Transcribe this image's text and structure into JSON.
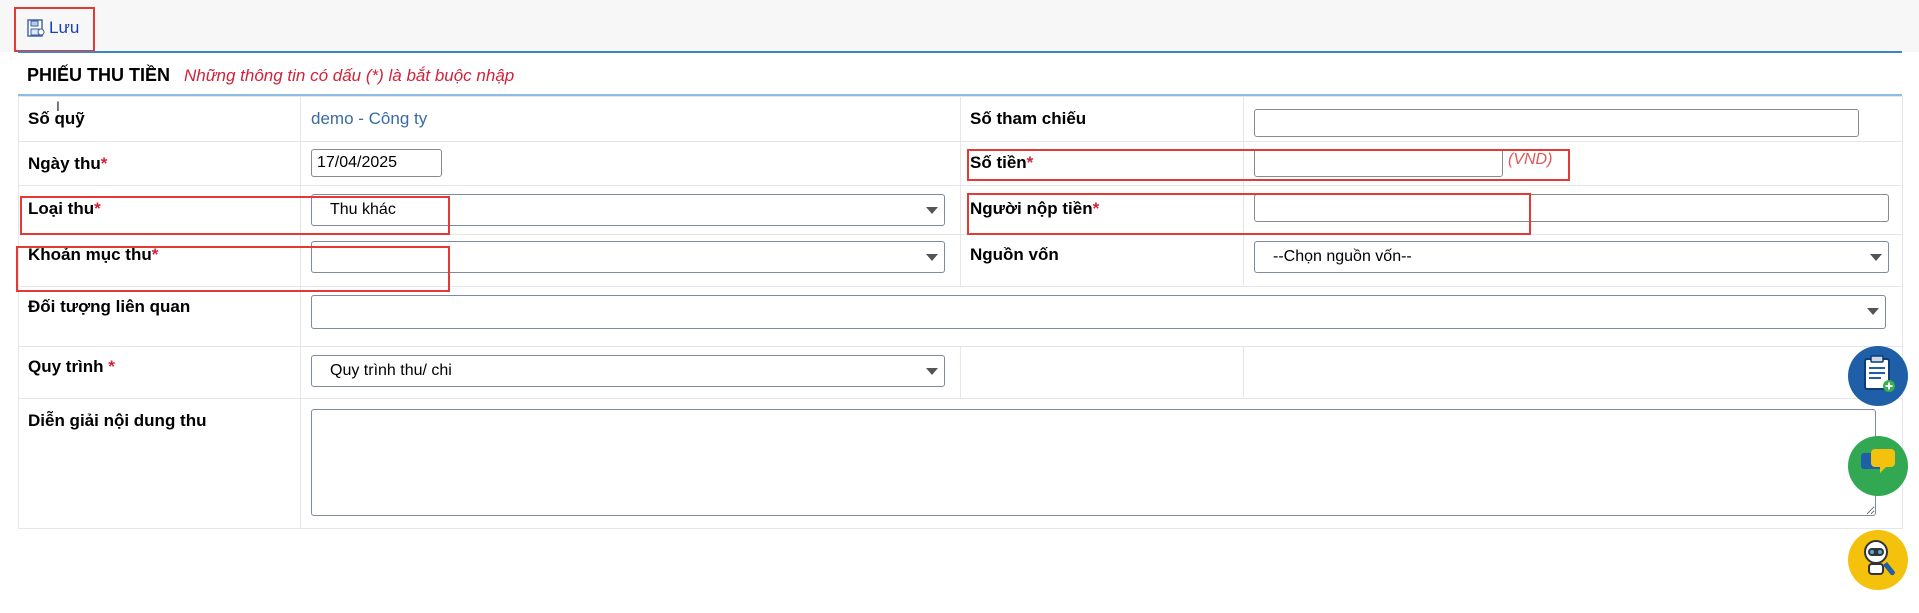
{
  "toolbar": {
    "save_label": "Lưu",
    "save_icon": "save-icon"
  },
  "header": {
    "title": "PHIẾU THU TIỀN",
    "note": "Những thông tin có dấu (*) là bắt buộc nhập"
  },
  "form": {
    "so_quy": {
      "label": "Số quỹ",
      "value": "demo - Công ty"
    },
    "so_tham_chieu": {
      "label": "Số tham chiếu",
      "value": ""
    },
    "ngay_thu": {
      "label": "Ngày thu",
      "required": "*",
      "value": "17/04/2025"
    },
    "so_tien": {
      "label": "Số tiền",
      "required": "*",
      "value": "",
      "unit": "(VND)"
    },
    "loai_thu": {
      "label": "Loại thu",
      "required": "*",
      "selected": "Thu khác"
    },
    "nguoi_nop_tien": {
      "label": "Người nộp tiền",
      "required": "*",
      "value": ""
    },
    "khoan_muc_thu": {
      "label": "Khoản mục thu",
      "required": "*",
      "selected": ""
    },
    "nguon_von": {
      "label": "Nguồn vốn",
      "selected": "--Chọn nguồn vốn--"
    },
    "doi_tuong": {
      "label": "Đối tượng liên quan",
      "selected": ""
    },
    "quy_trinh": {
      "label": "Quy trình",
      "required": " *",
      "selected": "Quy trình thu/ chi"
    },
    "dien_giai": {
      "label": "Diễn giải nội dung thu",
      "value": ""
    }
  },
  "floating_buttons": [
    {
      "name": "add-document-button",
      "icon": "clipboard-plus-icon",
      "color": "#1f5fa8"
    },
    {
      "name": "chat-button",
      "icon": "chat-bubble-icon",
      "color": "#33a852"
    },
    {
      "name": "support-bot-button",
      "icon": "robot-wrench-icon",
      "color": "#f4c20d"
    }
  ],
  "colors": {
    "accent": "#3a86c8",
    "required": "#d0233a",
    "highlight": "#e53935",
    "link_value": "#3a6aa6"
  }
}
